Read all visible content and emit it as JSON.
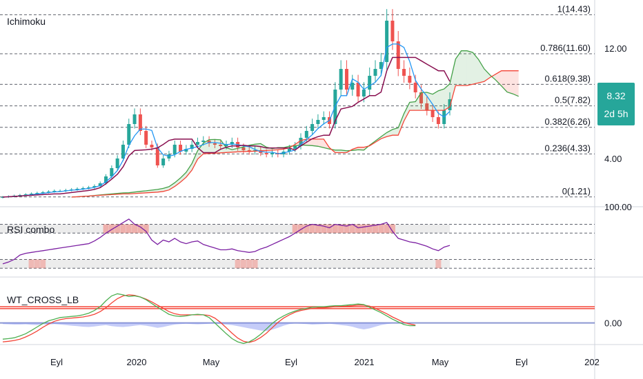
{
  "panes": {
    "main_title": "Ichimoku",
    "rsi_title": "RSI combo",
    "wt_title": "WT_CROSS_LB"
  },
  "price_tag": {
    "price": "8.32",
    "countdown": "2d 5h",
    "color": "#26a69a"
  },
  "colors": {
    "up": "#26a69a",
    "down": "#ef5350",
    "tenkan": "#2196f3",
    "kijun": "#880e4f",
    "span_a": "#43a047",
    "span_b": "#f44336",
    "rsi_line": "#7b1fa2",
    "wt1": "#4caf50",
    "wt2": "#f44336",
    "wt_hist": "#7e8ff0"
  },
  "chart_data": [
    {
      "type": "candlestick",
      "title": "Ichimoku",
      "price_axis_ticks": [
        "12.00",
        "4.00"
      ],
      "time_axis_ticks": [
        "Eyl",
        "2020",
        "May",
        "Eyl",
        "2021",
        "May",
        "Eyl",
        "202"
      ],
      "ylim": [
        0.5,
        15.5
      ],
      "fib_levels": [
        {
          "label": "1(14.43)",
          "value": 14.43
        },
        {
          "label": "0.786(11.60)",
          "value": 11.6
        },
        {
          "label": "0.618(9.38)",
          "value": 9.38
        },
        {
          "label": "0.5(7.82)",
          "value": 7.82
        },
        {
          "label": "0.382(6.26)",
          "value": 6.26
        },
        {
          "label": "0.236(4.33)",
          "value": 4.33
        },
        {
          "label": "0(1.21)",
          "value": 1.21
        }
      ],
      "last_price": 8.32,
      "close": [
        1.2,
        1.25,
        1.3,
        1.35,
        1.4,
        1.45,
        1.5,
        1.55,
        1.6,
        1.65,
        1.65,
        1.7,
        1.75,
        1.8,
        1.85,
        1.9,
        2.0,
        2.2,
        2.7,
        3.3,
        4.0,
        5.0,
        6.5,
        7.2,
        6.0,
        5.0,
        4.8,
        3.5,
        4.0,
        4.3,
        5.0,
        4.5,
        4.7,
        5.0,
        5.2,
        5.3,
        5.1,
        5.0,
        4.9,
        5.0,
        5.2,
        4.8,
        4.6,
        4.5,
        4.6,
        4.4,
        4.3,
        4.4,
        4.3,
        4.5,
        4.7,
        4.9,
        5.5,
        6.0,
        6.5,
        6.8,
        7.0,
        6.5,
        9.0,
        10.5,
        9.0,
        9.5,
        8.5,
        9.0,
        10.0,
        10.5,
        11.0,
        14.0,
        12.5,
        10.5,
        10.0,
        9.5,
        8.8,
        8.0,
        7.5,
        7.0,
        6.5,
        7.5,
        8.3
      ]
    },
    {
      "type": "line",
      "title": "RSI combo",
      "price_axis_ticks": [
        "100.00"
      ],
      "ylim": [
        20,
        100
      ],
      "band_upper": [
        70,
        80
      ],
      "band_lower": [
        30,
        40
      ],
      "values": [
        35,
        37,
        40,
        45,
        47,
        48,
        49,
        50,
        51,
        52,
        53,
        54,
        55,
        56,
        57,
        58,
        61,
        65,
        70,
        74,
        78,
        82,
        86,
        80,
        77,
        72,
        62,
        57,
        62,
        60,
        64,
        60,
        58,
        60,
        61,
        57,
        55,
        53,
        51,
        51,
        52,
        50,
        49,
        48,
        49,
        52,
        54,
        57,
        60,
        63,
        66,
        70,
        74,
        78,
        80,
        79,
        78,
        76,
        80,
        79,
        78,
        80,
        76,
        77,
        78,
        79,
        80,
        82,
        72,
        64,
        62,
        60,
        59,
        57,
        55,
        52,
        50,
        54,
        56
      ]
    },
    {
      "type": "line",
      "title": "WT_CROSS_LB",
      "price_axis_ticks": [
        "0.00"
      ],
      "ylim": [
        -80,
        170
      ],
      "ref_lines": [
        53,
        60
      ],
      "series": [
        {
          "values": [
            -60,
            -58,
            -55,
            -48,
            -40,
            -28,
            -15,
            -2,
            8,
            14,
            20,
            22,
            24,
            26,
            30,
            36,
            46,
            60,
            82,
            100,
            108,
            104,
            98,
            100,
            96,
            86,
            72,
            58,
            45,
            32,
            26,
            24,
            26,
            30,
            32,
            30,
            20,
            0,
            -20,
            -40,
            -58,
            -70,
            -76,
            -70,
            -58,
            -42,
            -22,
            -2,
            14,
            26,
            36,
            44,
            50,
            54,
            58,
            60,
            60,
            62,
            64,
            64,
            66,
            68,
            70,
            68,
            58,
            48,
            38,
            26,
            14,
            4,
            -6,
            -10,
            -10
          ]
        },
        {
          "values": [
            -70,
            -68,
            -65,
            -60,
            -52,
            -42,
            -30,
            -16,
            -4,
            6,
            12,
            16,
            18,
            20,
            22,
            26,
            32,
            42,
            56,
            74,
            90,
            100,
            104,
            102,
            96,
            88,
            78,
            66,
            54,
            42,
            34,
            30,
            30,
            30,
            30,
            30,
            28,
            18,
            2,
            -18,
            -38,
            -56,
            -68,
            -72,
            -66,
            -54,
            -38,
            -18,
            2,
            18,
            30,
            40,
            46,
            50,
            54,
            56,
            56,
            58,
            60,
            61,
            62,
            64,
            66,
            66,
            62,
            54,
            44,
            34,
            22,
            12,
            2,
            -4,
            -8
          ]
        },
        {
          "values": [
            -4,
            -5,
            -6,
            -6,
            -5,
            -7,
            -8,
            -5,
            -6,
            -4,
            -6,
            -8,
            -10,
            -12,
            -14,
            -15,
            -13,
            -10,
            -8,
            -12,
            -14,
            -15,
            -13,
            -10,
            -8,
            -10,
            -14,
            -18,
            -15,
            -10,
            -6,
            -4,
            -3,
            -4,
            -5,
            -4,
            -3,
            -2,
            -4,
            -6,
            -8,
            -12,
            -16,
            -20,
            -24,
            -28,
            -30,
            -25,
            -18,
            -10,
            -4,
            -2,
            -3,
            -4,
            -6,
            -5,
            -4,
            -3,
            -5,
            -8,
            -10,
            -14,
            -20,
            -24,
            -20,
            -14,
            -8,
            -4,
            -2
          ]
        }
      ]
    }
  ]
}
